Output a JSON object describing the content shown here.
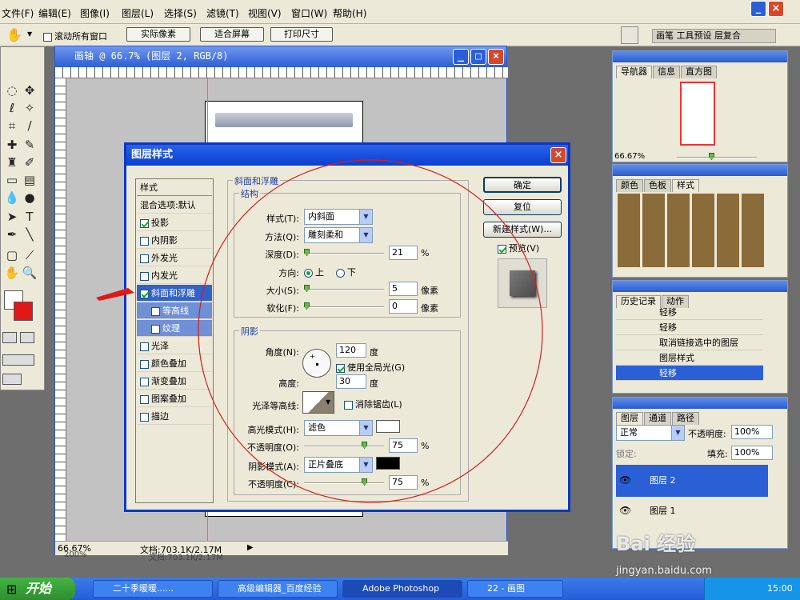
{
  "menu": [
    "文件(F)",
    "编辑(E)",
    "图像(I)",
    "图层(L)",
    "选择(S)",
    "滤镜(T)",
    "视图(V)",
    "窗口(W)",
    "帮助(H)"
  ],
  "options": {
    "scroll_all": "滚动所有窗口",
    "actual_pixels": "实际像素",
    "fit_screen": "适合屏幕",
    "print_size": "打印尺寸",
    "well_tabs": "画笔 工具预设 层复合"
  },
  "doc": {
    "title": "画轴 @ 66.7% (图层 2, RGB/8)",
    "zoom": "66.67%",
    "status": "文档:703.1K/2.17M",
    "ghost_zoom": "200%",
    "ghost_status": "文档:703.1K/2.17M"
  },
  "navigator": {
    "tabs": [
      "导航器",
      "信息",
      "直方图"
    ],
    "zoom": "66.67%"
  },
  "styles_panel": {
    "tabs": [
      "颜色",
      "色板",
      "样式"
    ]
  },
  "history": {
    "tabs": [
      "历史记录",
      "动作"
    ],
    "items": [
      "轻移",
      "轻移",
      "取消链接选中的图层",
      "图层样式",
      "轻移"
    ],
    "selected": 4
  },
  "layers": {
    "tabs": [
      "图层",
      "通道",
      "路径"
    ],
    "mode": "正常",
    "opacity_label": "不透明度:",
    "opacity": "100%",
    "lock_label": "锁定:",
    "fill_label": "填充:",
    "fill": "100%",
    "items": [
      "图层 2",
      "图层 1"
    ]
  },
  "dialog": {
    "title": "图层样式",
    "list_header": "样式",
    "blend": "混合选项:默认",
    "items": [
      "投影",
      "内阴影",
      "外发光",
      "内发光",
      "斜面和浮雕",
      "等高线",
      "纹理",
      "光泽",
      "颜色叠加",
      "渐变叠加",
      "图案叠加",
      "描边"
    ],
    "checked": [
      true,
      false,
      false,
      false,
      true,
      false,
      false,
      false,
      false,
      false,
      false,
      false
    ],
    "selected": "斜面和浮雕",
    "section_title": "斜面和浮雕",
    "structure": "结构",
    "style_label": "样式(T):",
    "style_value": "内斜面",
    "technique_label": "方法(Q):",
    "technique_value": "雕刻柔和",
    "depth_label": "深度(D):",
    "depth_value": "21",
    "depth_unit": "%",
    "direction_label": "方向:",
    "dir_up": "上",
    "dir_down": "下",
    "size_label": "大小(S):",
    "size_value": "5",
    "size_unit": "像素",
    "soften_label": "软化(F):",
    "soften_value": "0",
    "soften_unit": "像素",
    "shading": "阴影",
    "angle_label": "角度(N):",
    "angle_value": "120",
    "angle_unit": "度",
    "global_light": "使用全局光(G)",
    "altitude_label": "高度:",
    "altitude_value": "30",
    "altitude_unit": "度",
    "gloss_label": "光泽等高线:",
    "antialias": "消除锯齿(L)",
    "highlight_label": "高光模式(H):",
    "highlight_value": "滤色",
    "hl_opacity_label": "不透明度(O):",
    "hl_opacity_value": "75",
    "hl_opacity_unit": "%",
    "shadow_label": "阴影模式(A):",
    "shadow_value": "正片叠底",
    "sh_opacity_label": "不透明度(C):",
    "sh_opacity_value": "75",
    "sh_opacity_unit": "%",
    "ok": "确定",
    "reset": "复位",
    "new_style": "新建样式(W)...",
    "preview": "预览(V)"
  },
  "taskbar": {
    "start": "开始",
    "tasks": [
      "二十季暖暖......",
      "高级编辑器_百度经验",
      "Adobe Photoshop",
      "22 - 画图"
    ],
    "clock": "15:00"
  },
  "watermark": {
    "brand": "Bai 经验",
    "url": "jingyan.baidu.com"
  },
  "colors": {
    "highlight": "#ffffff",
    "shadow": "#000000",
    "accent": "#2a5fd6"
  }
}
